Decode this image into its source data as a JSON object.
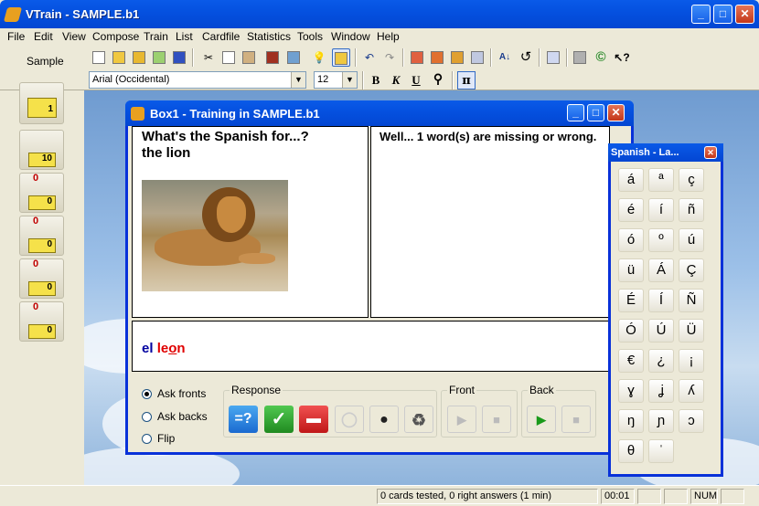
{
  "app": {
    "title": "VTrain - SAMPLE.b1"
  },
  "menu": [
    "File",
    "Edit",
    "View",
    "Compose",
    "Train",
    "List",
    "Cardfile",
    "Statistics",
    "Tools",
    "Window",
    "Help"
  ],
  "sidebar": {
    "label": "Sample",
    "boxes": [
      {
        "count": "",
        "cube": "1"
      },
      {
        "count": "",
        "cube": "10"
      },
      {
        "count": "0",
        "cube": "0"
      },
      {
        "count": "0",
        "cube": "0"
      },
      {
        "count": "0",
        "cube": "0"
      },
      {
        "count": "0",
        "cube": "0"
      }
    ]
  },
  "format": {
    "font": "Arial (Occidental)",
    "size": "12",
    "bold": "B",
    "italic": "K",
    "underline": "U",
    "pi": "π"
  },
  "training": {
    "title": "Box1 - Training in SAMPLE.b1",
    "question_line1": "What's the Spanish for...?",
    "question_line2": "the lion",
    "feedback": "Well... 1 word(s) are missing or wrong.",
    "answer_part1": "el ",
    "answer_part2": "le",
    "answer_part3": "o",
    "answer_part4": "n",
    "modes": [
      "Ask fronts",
      "Ask backs",
      "Flip"
    ],
    "selected_mode": "Ask fronts",
    "response_label": "Response",
    "front_label": "Front",
    "back_label": "Back",
    "colors": {
      "answer_ok": "#0000a0",
      "answer_wrong": "#e00000",
      "title_blue": "#0346d2"
    }
  },
  "charpad": {
    "title": "Spanish - La...",
    "chars": [
      "á",
      "ª",
      "ç",
      "é",
      "í",
      "ñ",
      "ó",
      "º",
      "ú",
      "ü",
      "Á",
      "Ç",
      "É",
      "Í",
      "Ñ",
      "Ó",
      "Ú",
      "Ü",
      "€",
      "¿",
      "¡",
      "ɣ",
      "ʝ",
      "ʎ",
      "ŋ",
      "ɲ",
      "ɔ",
      "θ",
      "ˈ"
    ]
  },
  "status": {
    "message": "0 cards tested, 0 right answers (1 min)",
    "time": "00:01",
    "num": "NUM"
  }
}
